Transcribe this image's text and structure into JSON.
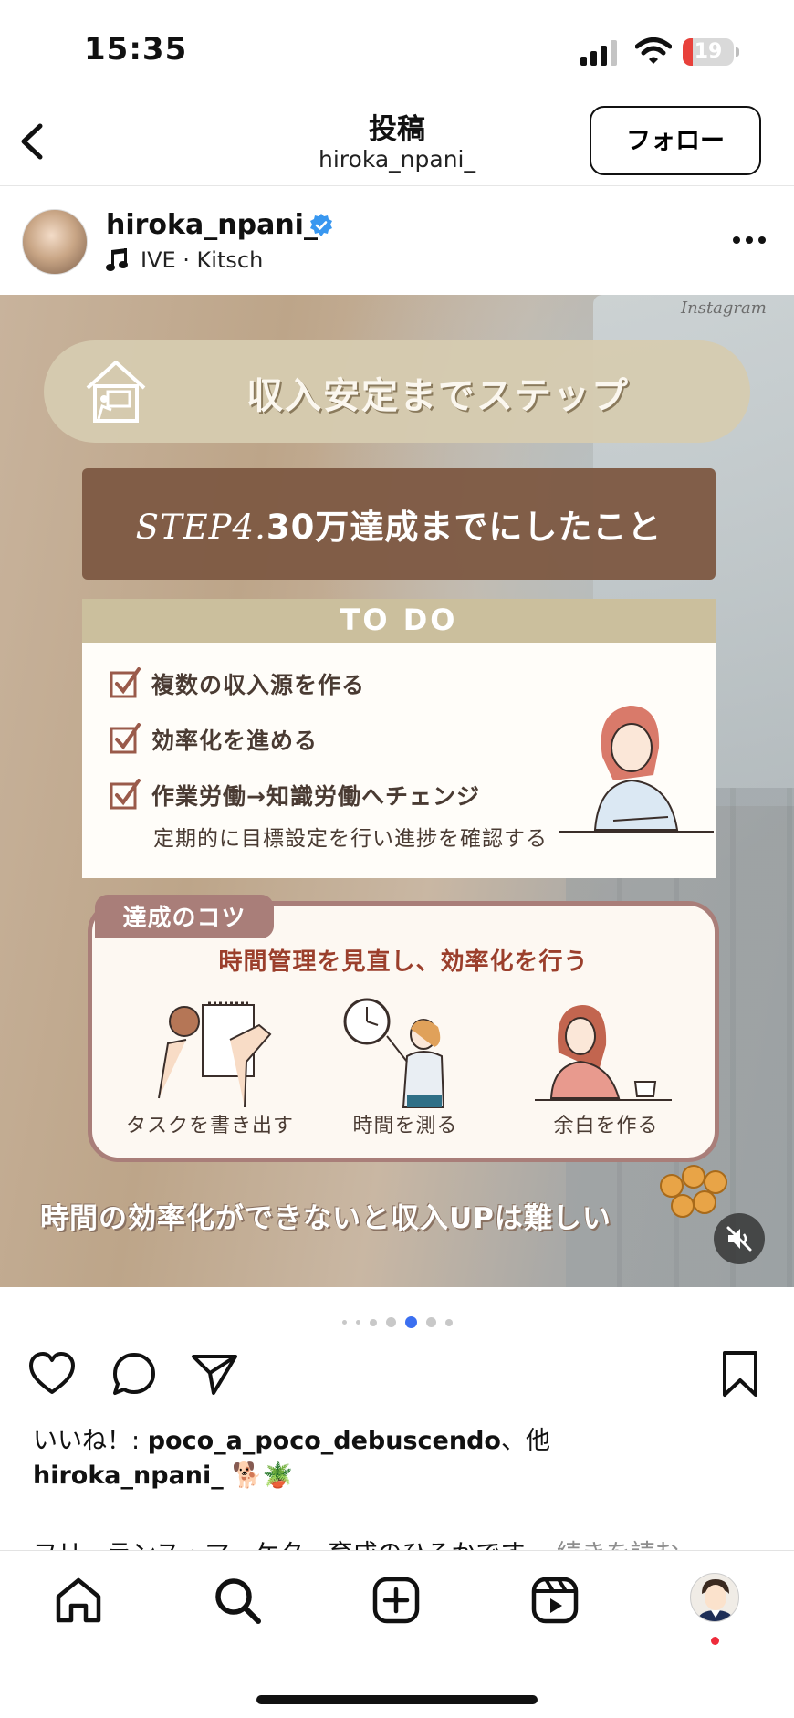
{
  "status_bar": {
    "time": "15:35",
    "battery_level": "19",
    "battery_fraction": 0.19,
    "battery_color": "#e8413b",
    "icons": [
      "signal-icon",
      "wifi-icon",
      "battery-icon"
    ]
  },
  "header": {
    "title": "投稿",
    "subtitle": "hiroka_npani_",
    "follow_label": "フォロー"
  },
  "post": {
    "username": "hiroka_npani_",
    "music": "IVE · Kitsch",
    "image": {
      "laptop_label": "Instagram",
      "title": "収入安定までステップ",
      "step_prefix": "STEP4.",
      "step_text": "30万達成までにしたこと",
      "todo_heading": "TO DO",
      "todo_items": [
        "複数の収入源を作る",
        "効率化を進める",
        "作業労働→知識労働へチェンジ"
      ],
      "todo_note": "定期的に目標設定を行い進捗を確認する",
      "tips_tab": "達成のコツ",
      "tips_heading": "時間管理を見直し、効率化を行う",
      "tips": [
        "タスクを書き出す",
        "時間を測る",
        "余白を作る"
      ],
      "caption": "時間の効率化ができないと収入UPは難しい"
    },
    "carousel": {
      "count": 7,
      "active_index": 4
    },
    "likes_prefix": "いいね！: ",
    "likes_user": "poco_a_poco_debuscendo",
    "likes_suffix": "、他",
    "caption_user": "hiroka_npani_",
    "caption_emoji": "🐕🪴",
    "caption_preview": "フリーランス・マーケター育成のひろかです...",
    "caption_more": "続きを読む"
  },
  "colors": {
    "accent_brown": "#7e5a44",
    "todo_header": "#cbbf9d",
    "tips_border": "#a97e79",
    "tips_heading": "#9b3f2c",
    "verified_blue": "#3897f0",
    "notification_dot": "#ee2b3b"
  }
}
